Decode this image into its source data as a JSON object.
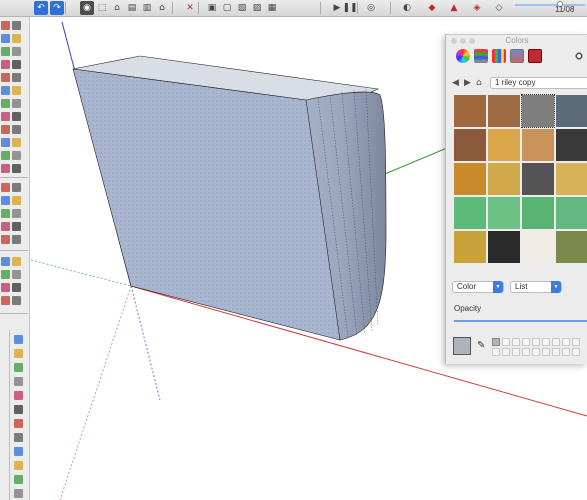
{
  "toolbar": {
    "scene_label": "11/08",
    "tools": [
      {
        "icon": "undo-icon",
        "glyph": "↶",
        "style": "blue"
      },
      {
        "icon": "redo-icon",
        "glyph": "↷",
        "style": "blue"
      },
      {
        "icon": "camera-orbit-icon",
        "glyph": "◉",
        "style": "dark"
      },
      {
        "icon": "iso-view-icon",
        "glyph": "⬚",
        "style": "plain"
      },
      {
        "icon": "top-view-icon",
        "glyph": "⌂",
        "style": "plain"
      },
      {
        "icon": "front-view-icon",
        "glyph": "▤",
        "style": "plain"
      },
      {
        "icon": "right-view-icon",
        "glyph": "▥",
        "style": "plain"
      },
      {
        "icon": "home-view-icon",
        "glyph": "⌂",
        "style": "plain"
      },
      {
        "icon": "xray-icon",
        "glyph": "✕",
        "style": "red"
      },
      {
        "icon": "wireframe-icon",
        "glyph": "▣",
        "style": "plain"
      },
      {
        "icon": "hidden-line-icon",
        "glyph": "▢",
        "style": "plain"
      },
      {
        "icon": "shaded-icon",
        "glyph": "▧",
        "style": "plain"
      },
      {
        "icon": "shaded-texture-icon",
        "glyph": "▨",
        "style": "plain"
      },
      {
        "icon": "monochrome-icon",
        "glyph": "▦",
        "style": "plain"
      },
      {
        "icon": "play-icon",
        "glyph": "▶",
        "style": "plain"
      },
      {
        "icon": "pause-icon",
        "glyph": "❚❚",
        "style": "plain"
      },
      {
        "icon": "component-icon",
        "glyph": "◎",
        "style": "plain"
      },
      {
        "icon": "shadows-icon",
        "glyph": "◐",
        "style": "plain"
      },
      {
        "icon": "extension-ruby-icon",
        "glyph": "◆",
        "style": "red"
      },
      {
        "icon": "extension-3d-warehouse-icon",
        "glyph": "▲",
        "style": "red"
      },
      {
        "icon": "extension-sketchup-icon",
        "glyph": "◈",
        "style": "red"
      },
      {
        "icon": "extension-layers-icon",
        "glyph": "◇",
        "style": "plain"
      }
    ]
  },
  "colors_panel": {
    "title": "Colors",
    "library": "1 riley copy",
    "color_mode": "Color",
    "view_mode": "List",
    "opacity_label": "Opacity",
    "opacity_value": 1.0,
    "swatches": [
      "#a0693d",
      "#9d6a42",
      "#7e7e7e",
      "#5c6b7a",
      "#8a5a3a",
      "#d9a64a",
      "#c9935a",
      "#3a3a3a",
      "#c88a2a",
      "#d1a84a",
      "#545454",
      "#d7b258",
      "#5dbb7a",
      "#6cc285",
      "#59b474",
      "#62b87e",
      "#c9a23a",
      "#2b2b2b",
      "#f0ede4",
      "#7b8a4a"
    ]
  }
}
